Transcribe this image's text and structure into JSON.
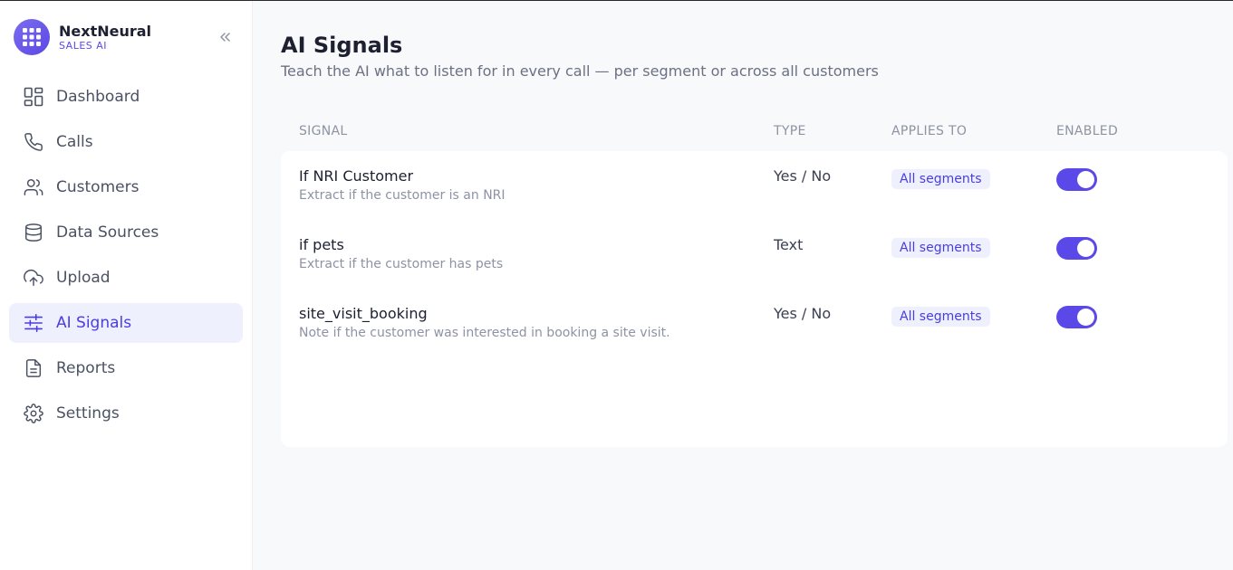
{
  "brand": {
    "name": "NextNeural",
    "subtitle": "SALES AI"
  },
  "nav": [
    {
      "label": "Dashboard",
      "icon": "dashboard-icon"
    },
    {
      "label": "Calls",
      "icon": "phone-icon"
    },
    {
      "label": "Customers",
      "icon": "users-icon"
    },
    {
      "label": "Data Sources",
      "icon": "database-icon"
    },
    {
      "label": "Upload",
      "icon": "upload-cloud-icon"
    },
    {
      "label": "AI Signals",
      "icon": "sliders-icon",
      "active": true
    },
    {
      "label": "Reports",
      "icon": "document-icon"
    },
    {
      "label": "Settings",
      "icon": "gear-icon"
    }
  ],
  "page": {
    "title": "AI Signals",
    "subtitle": "Teach the AI what to listen for in every call — per segment or across all customers"
  },
  "table": {
    "headers": {
      "signal": "SIGNAL",
      "type": "TYPE",
      "applies": "APPLIES TO",
      "enabled": "ENABLED"
    },
    "rows": [
      {
        "name": "If NRI Customer",
        "description": "Extract if the customer is an NRI",
        "type": "Yes / No",
        "applies_to": "All segments",
        "enabled": true
      },
      {
        "name": "if pets",
        "description": "Extract if the customer has pets",
        "type": "Text",
        "applies_to": "All segments",
        "enabled": true
      },
      {
        "name": "site_visit_booking",
        "description": "Note if the customer was interested in booking a site visit.",
        "type": "Yes / No",
        "applies_to": "All segments",
        "enabled": true
      }
    ]
  },
  "colors": {
    "accent": "#5a48e8",
    "active_bg": "#eef0fd"
  }
}
